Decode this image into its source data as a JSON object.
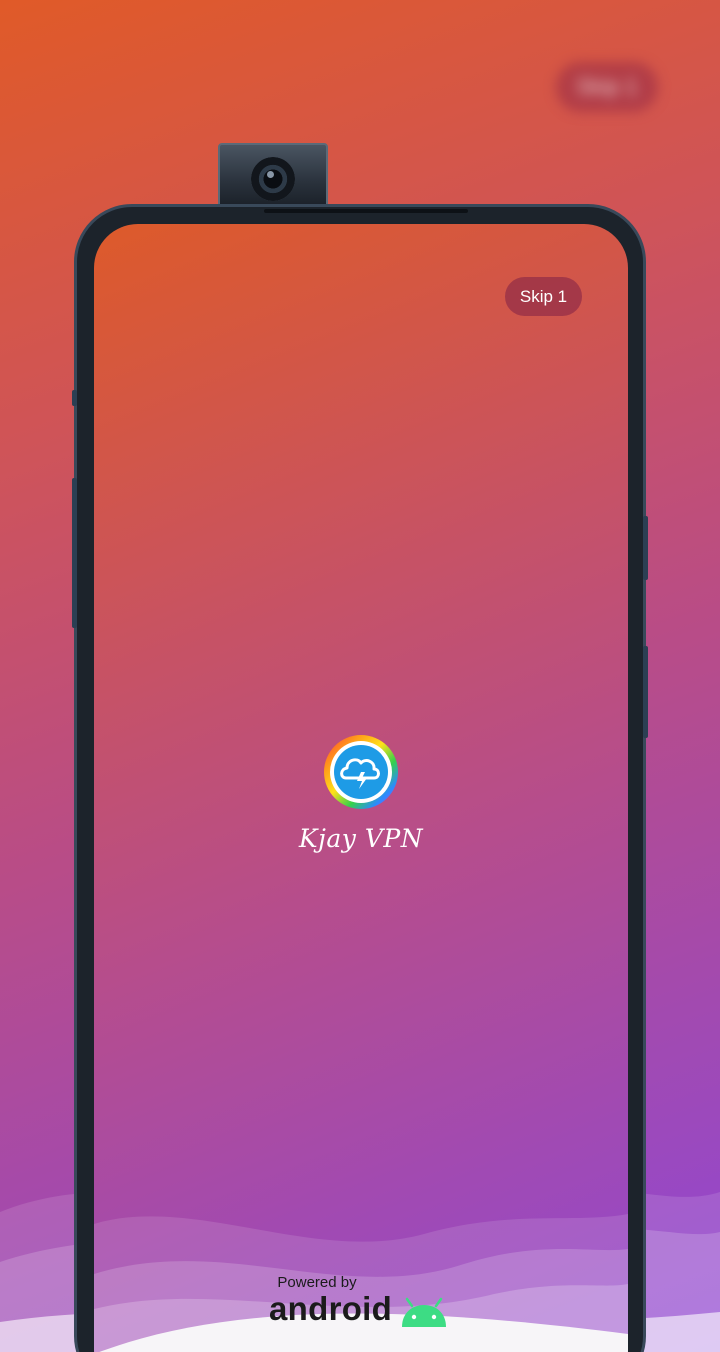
{
  "background": {
    "skip_label": "Skip 1"
  },
  "splash": {
    "skip_label": "Skip 1",
    "app_name": "Kjay VPN",
    "powered_by": "Powered by",
    "platform": "android",
    "logo_icon": "cloud-lightning-icon",
    "robot_icon": "android-robot-icon"
  },
  "colors": {
    "gradient_start": "#dd5a2a",
    "gradient_end": "#9147d2",
    "android_green": "#3ddc84",
    "logo_blue": "#1e9be6"
  }
}
